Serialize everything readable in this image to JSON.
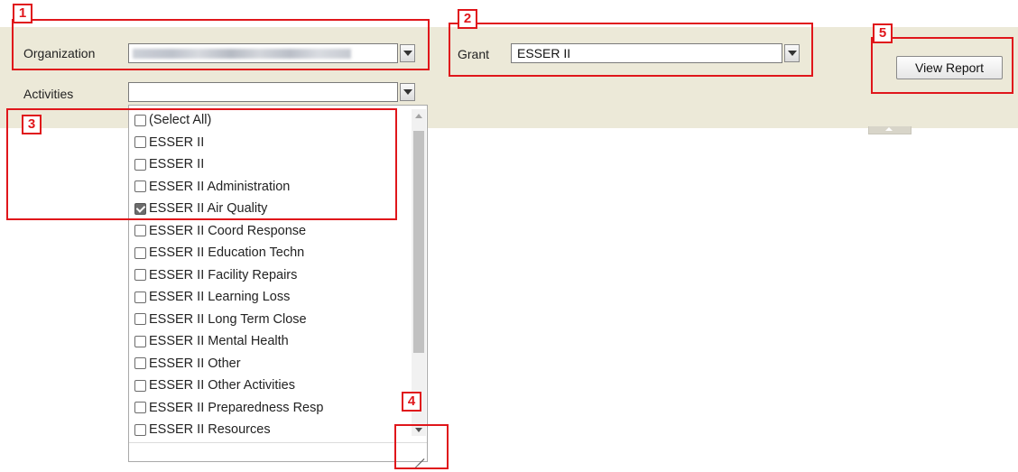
{
  "parameters": {
    "organization": {
      "label": "Organization"
    },
    "grant": {
      "label": "Grant",
      "value": "ESSER II"
    },
    "activities": {
      "label": "Activities",
      "value": "",
      "options": [
        {
          "label": "(Select All)",
          "checked": false
        },
        {
          "label": "ESSER II",
          "checked": false
        },
        {
          "label": "ESSER II",
          "checked": false
        },
        {
          "label": "ESSER II Administration",
          "checked": false
        },
        {
          "label": "ESSER II Air Quality",
          "checked": true
        },
        {
          "label": "ESSER II Coord Response",
          "checked": false
        },
        {
          "label": "ESSER II Education Techn",
          "checked": false
        },
        {
          "label": "ESSER II Facility Repairs",
          "checked": false
        },
        {
          "label": "ESSER II Learning Loss",
          "checked": false
        },
        {
          "label": "ESSER II Long Term Close",
          "checked": false
        },
        {
          "label": "ESSER II Mental Health",
          "checked": false
        },
        {
          "label": "ESSER II Other",
          "checked": false
        },
        {
          "label": "ESSER II Other Activities",
          "checked": false
        },
        {
          "label": "ESSER II Preparedness Resp",
          "checked": false
        },
        {
          "label": "ESSER II Resources",
          "checked": false
        }
      ]
    }
  },
  "toolbar": {
    "view_report_label": "View Report"
  },
  "callouts": [
    {
      "number": "1"
    },
    {
      "number": "2"
    },
    {
      "number": "3"
    },
    {
      "number": "4"
    },
    {
      "number": "5"
    }
  ],
  "colors": {
    "callout": "#e0161b",
    "parameter_band": "#ece9d8"
  }
}
